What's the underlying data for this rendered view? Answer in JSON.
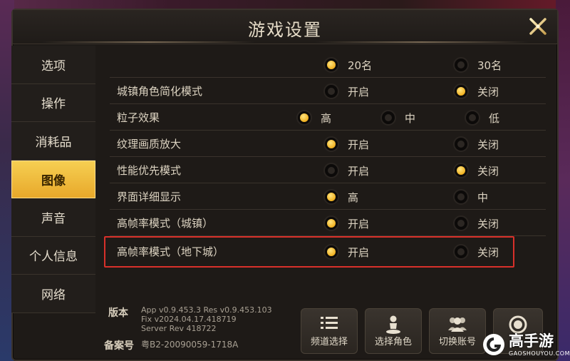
{
  "title": "游戏设置",
  "sidebar": {
    "items": [
      {
        "label": "选项",
        "active": false
      },
      {
        "label": "操作",
        "active": false
      },
      {
        "label": "消耗品",
        "active": false
      },
      {
        "label": "图像",
        "active": true
      },
      {
        "label": "声音",
        "active": false
      },
      {
        "label": "个人信息",
        "active": false
      },
      {
        "label": "网络",
        "active": false
      }
    ]
  },
  "settings": {
    "rows": [
      {
        "label": "",
        "options": [
          {
            "label": "20名",
            "selected": true
          },
          {
            "label": "30名",
            "selected": false
          }
        ]
      },
      {
        "label": "城镇角色简化模式",
        "options": [
          {
            "label": "开启",
            "selected": false
          },
          {
            "label": "关闭",
            "selected": true
          }
        ]
      },
      {
        "label": "粒子效果",
        "options": [
          {
            "label": "高",
            "selected": true
          },
          {
            "label": "中",
            "selected": false
          },
          {
            "label": "低",
            "selected": false
          }
        ]
      },
      {
        "label": "纹理画质放大",
        "options": [
          {
            "label": "开启",
            "selected": true
          },
          {
            "label": "关闭",
            "selected": false
          }
        ]
      },
      {
        "label": "性能优先模式",
        "options": [
          {
            "label": "开启",
            "selected": false
          },
          {
            "label": "关闭",
            "selected": true
          }
        ]
      },
      {
        "label": "界面详细显示",
        "options": [
          {
            "label": "高",
            "selected": true
          },
          {
            "label": "中",
            "selected": false
          }
        ]
      },
      {
        "label": "高帧率模式（城镇）",
        "options": [
          {
            "label": "开启",
            "selected": true
          },
          {
            "label": "关闭",
            "selected": false
          }
        ]
      },
      {
        "label": "高帧率模式（地下城）",
        "options": [
          {
            "label": "开启",
            "selected": true
          },
          {
            "label": "关闭",
            "selected": false
          }
        ]
      }
    ]
  },
  "footer": {
    "version_label": "版本",
    "version_line1": "App v0.9.453.3 Res v0.9.453.103",
    "version_line2": "Fix v2024.04.17.418719",
    "version_line3": "Server Rev 418722",
    "record_label": "备案号",
    "record_value": "粤B2-20090059-1718A"
  },
  "buttons": {
    "channel": "频道选择",
    "character": "选择角色",
    "account": "切换账号"
  },
  "watermark": {
    "text": "高手游",
    "sub": "GAOSHOUYOU.COM"
  },
  "colors": {
    "accent": "#f0b020",
    "highlight_box": "#d8302a"
  }
}
